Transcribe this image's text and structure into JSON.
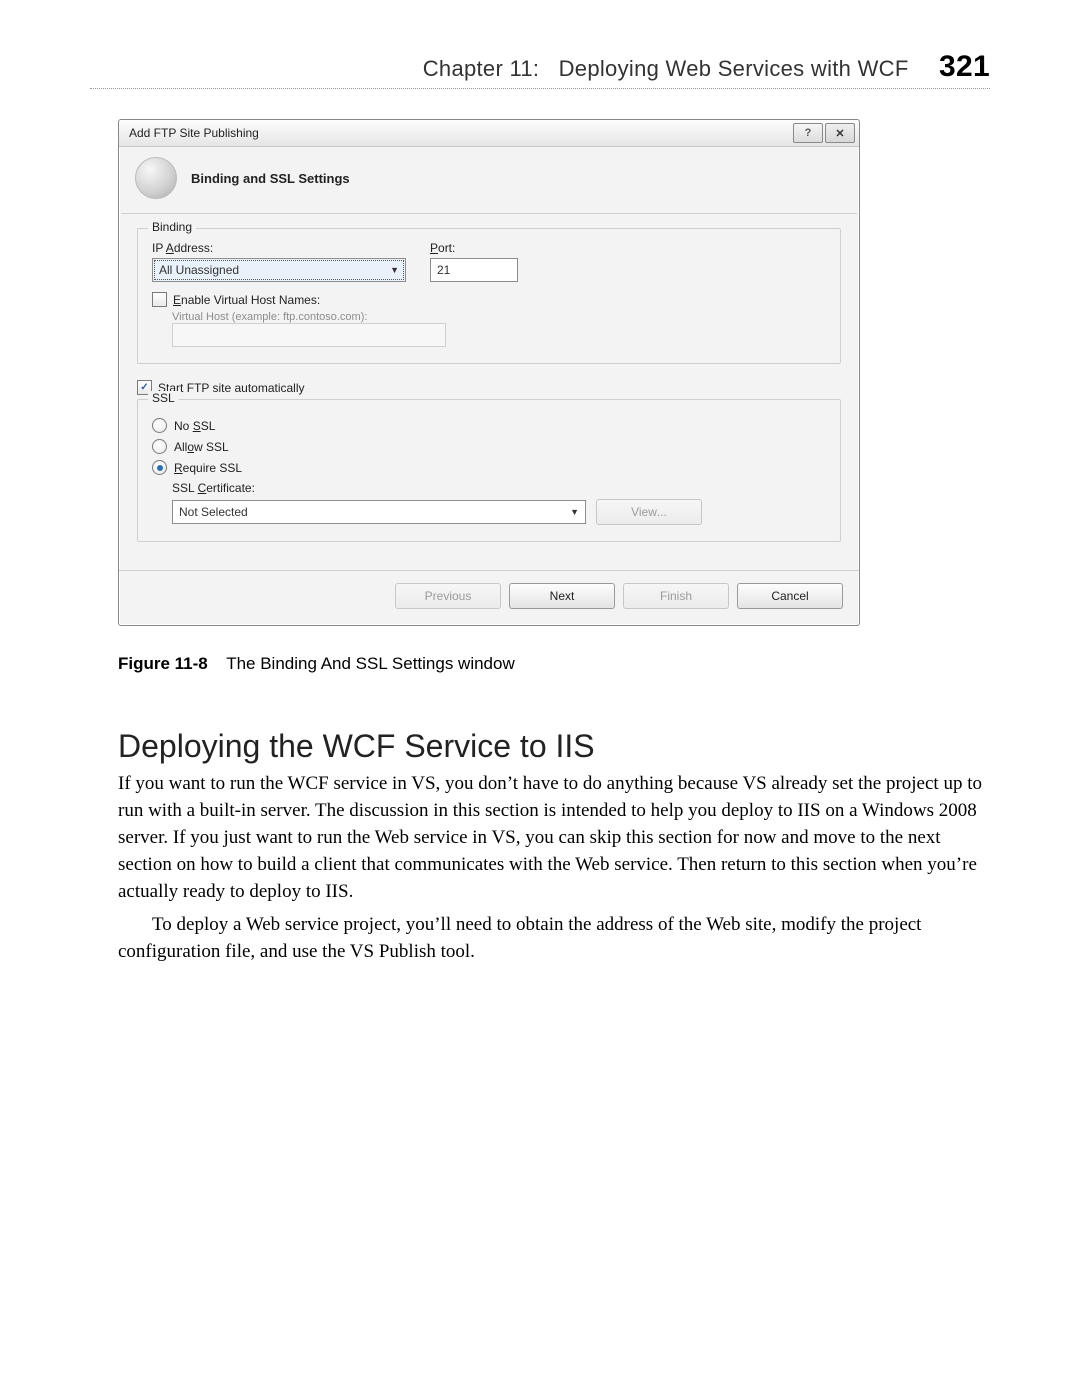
{
  "runhead": {
    "chapter": "Chapter 11:",
    "title": "Deploying Web Services with WCF",
    "page": "321"
  },
  "dialog": {
    "window_title": "Add FTP Site Publishing",
    "heading": "Binding and SSL Settings",
    "binding": {
      "legend": "Binding",
      "ip_label_pre": "IP ",
      "ip_label_accel": "A",
      "ip_label_post": "ddress:",
      "ip_value": "All Unassigned",
      "port_label_accel": "P",
      "port_label_post": "ort:",
      "port_value": "21",
      "enable_vhost_accel": "E",
      "enable_vhost_post": "nable Virtual Host Names:",
      "vhost_hint_accel": "V",
      "vhost_hint_post": "irtual Host (example: ftp.contoso.com):",
      "vhost_value": ""
    },
    "start_auto_accel": "S",
    "start_auto_post": "tart FTP site automatically",
    "ssl": {
      "legend": "SSL",
      "no_ssl_pre": "No ",
      "no_ssl_accel": "S",
      "no_ssl_post": "SL",
      "allow_pre": "All",
      "allow_accel": "o",
      "allow_post": "w SSL",
      "require_accel": "R",
      "require_post": "equire SSL",
      "cert_pre": "SSL ",
      "cert_accel": "C",
      "cert_post": "ertificate:",
      "cert_value": "Not Selected",
      "view_pre": "Vie",
      "view_accel": "w",
      "view_post": "..."
    },
    "buttons": {
      "prev_accel": "P",
      "prev_post": "revious",
      "next_accel": "N",
      "next_post": "ext",
      "finish_accel": "F",
      "finish_post": "inish",
      "cancel": "Cancel"
    }
  },
  "caption": {
    "label": "Figure 11-8",
    "text": "The Binding And SSL Settings window"
  },
  "section": {
    "heading": "Deploying the WCF Service to IIS"
  },
  "para1": "If you want to run the WCF service in VS, you don’t have to do anything because VS already set the project up to run with a built-in server. The discussion in this section is intended to help you deploy to IIS on a Windows 2008 server. If you just want to run the Web service in VS, you can skip this section for now and move to the next section on how to build a client that communicates with the Web service. Then return to this section when you’re actually ready to deploy to IIS.",
  "para2": "To deploy a Web service project, you’ll need to obtain the address of the Web site, modify the project configuration file, and use the VS Publish tool."
}
